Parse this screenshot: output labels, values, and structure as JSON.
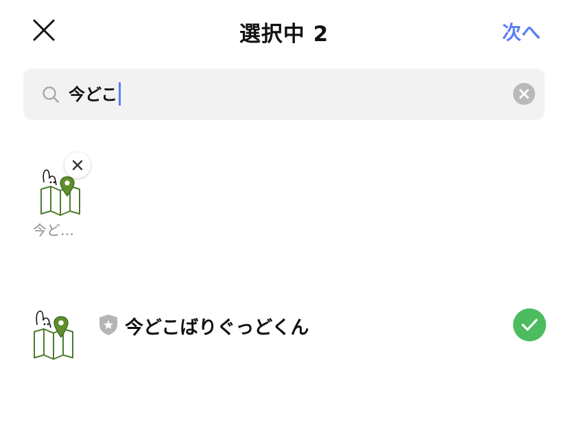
{
  "header": {
    "close_icon": "close-icon",
    "title": "選択中 2",
    "next_label": "次へ",
    "accent_color": "#5b7ef6"
  },
  "search": {
    "icon": "search-icon",
    "value": "今どこ",
    "clear_icon": "clear-circle-icon"
  },
  "selected": {
    "items": [
      {
        "label": "今ど…",
        "image": "map-sticker-with-pin-and-rabbit",
        "remove_icon": "remove-x-icon"
      }
    ]
  },
  "results": {
    "items": [
      {
        "image": "map-sticker-with-pin-and-rabbit",
        "badge_icon": "shield-star-icon",
        "title": "今どこばりぐっどくん",
        "selected": true,
        "check_color": "#4cbc5f"
      }
    ]
  }
}
